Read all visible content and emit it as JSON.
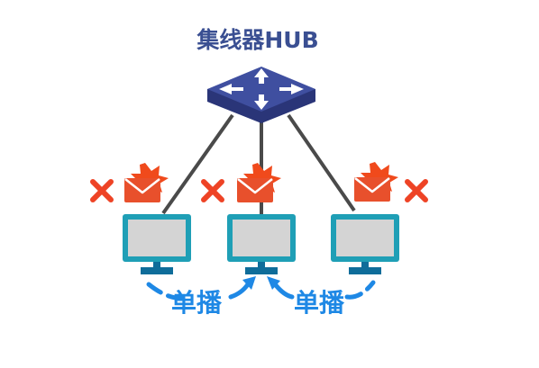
{
  "hub": {
    "label": "集线器HUB",
    "top_color": "#3f4fa0",
    "side_color": "#2a3578",
    "arrow_color": "#ffffff"
  },
  "cables": {
    "color": "#4a4a4a"
  },
  "computers": [
    {
      "id": "pc-left",
      "mail_icon": "mail-burst-icon",
      "reject_icon": "red-x-icon"
    },
    {
      "id": "pc-middle",
      "mail_icon": "mail-burst-icon",
      "reject_icon": "red-x-icon"
    },
    {
      "id": "pc-right",
      "mail_icon": "mail-burst-icon",
      "reject_icon": "red-x-icon"
    }
  ],
  "monitor": {
    "frame_color": "#1f9fb6",
    "screen_color": "#d4d4d4",
    "stand_color": "#0f6d9a"
  },
  "mail": {
    "envelope_color": "#e8502c",
    "burst_color": "#f04a1c"
  },
  "reject_color": "#ee4325",
  "arrow_color": "#1e88e5",
  "flow_labels": {
    "left": "单播",
    "right": "单播"
  }
}
